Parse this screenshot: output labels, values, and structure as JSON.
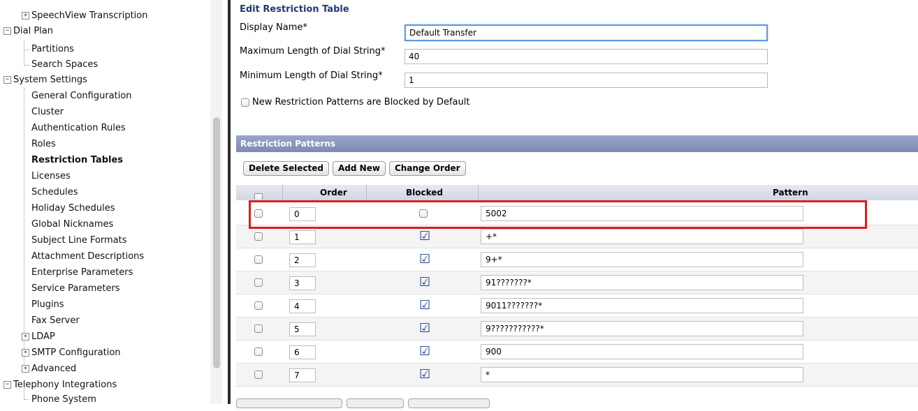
{
  "nav": {
    "items": [
      {
        "label": "SpeechView Transcription",
        "expander": "+"
      },
      {
        "label": "Dial Plan",
        "expander": "−"
      },
      {
        "label": "Partitions"
      },
      {
        "label": "Search Spaces"
      },
      {
        "label": "System Settings",
        "expander": "−"
      },
      {
        "label": "General Configuration"
      },
      {
        "label": "Cluster"
      },
      {
        "label": "Authentication Rules"
      },
      {
        "label": "Roles"
      },
      {
        "label": "Restriction Tables",
        "selected": true
      },
      {
        "label": "Licenses"
      },
      {
        "label": "Schedules"
      },
      {
        "label": "Holiday Schedules"
      },
      {
        "label": "Global Nicknames"
      },
      {
        "label": "Subject Line Formats"
      },
      {
        "label": "Attachment Descriptions"
      },
      {
        "label": "Enterprise Parameters"
      },
      {
        "label": "Service Parameters"
      },
      {
        "label": "Plugins"
      },
      {
        "label": "Fax Server"
      },
      {
        "label": "LDAP",
        "expander": "+"
      },
      {
        "label": "SMTP Configuration",
        "expander": "+"
      },
      {
        "label": "Advanced",
        "expander": "+"
      },
      {
        "label": "Telephony Integrations",
        "expander": "−"
      },
      {
        "label": "Phone System"
      }
    ]
  },
  "form": {
    "section_title": "Edit Restriction Table",
    "display_name_label": "Display Name*",
    "display_name_value": "Default Transfer",
    "max_len_label": "Maximum Length of Dial String*",
    "max_len_value": "40",
    "min_len_label": "Minimum Length of Dial String*",
    "min_len_value": "1",
    "blocked_default_label": "New Restriction Patterns are Blocked by Default",
    "blocked_default_checked": false
  },
  "patterns": {
    "header": "Restriction Patterns",
    "buttons": {
      "delete": "Delete Selected",
      "add": "Add New",
      "change_order": "Change Order"
    },
    "columns": {
      "order": "Order",
      "blocked": "Blocked",
      "pattern": "Pattern"
    },
    "rows": [
      {
        "order": "0",
        "blocked": false,
        "pattern": "5002"
      },
      {
        "order": "1",
        "blocked": true,
        "pattern": "+*"
      },
      {
        "order": "2",
        "blocked": true,
        "pattern": "9+*"
      },
      {
        "order": "3",
        "blocked": true,
        "pattern": "91???????*"
      },
      {
        "order": "4",
        "blocked": true,
        "pattern": "9011???????*"
      },
      {
        "order": "5",
        "blocked": true,
        "pattern": "9???????????*"
      },
      {
        "order": "6",
        "blocked": true,
        "pattern": "900"
      },
      {
        "order": "7",
        "blocked": true,
        "pattern": "*"
      }
    ]
  },
  "colors": {
    "panel_header": "#7d8ab5",
    "highlight": "#d62020",
    "section_title": "#1d3b6f",
    "check": "#1c3f8a"
  }
}
